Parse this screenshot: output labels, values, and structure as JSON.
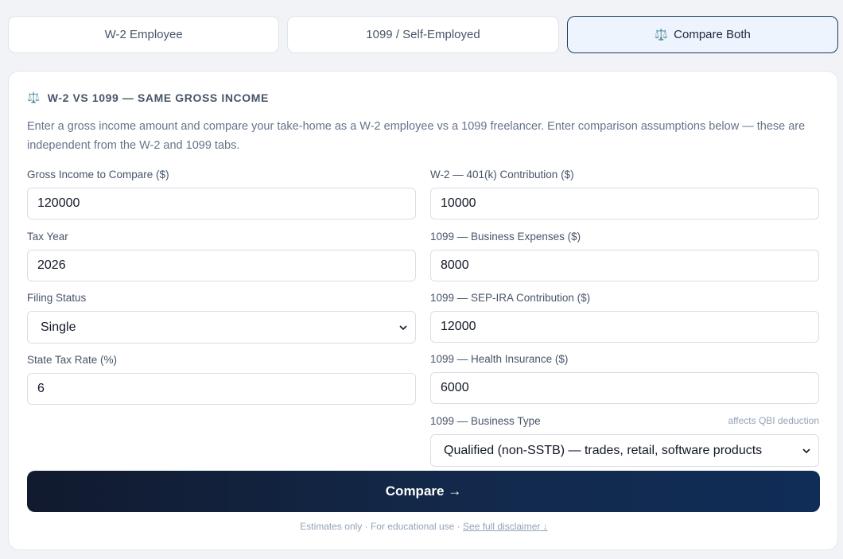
{
  "tabs": [
    {
      "label": "W-2 Employee",
      "icon": ""
    },
    {
      "label": "1099 / Self-Employed",
      "icon": ""
    },
    {
      "label": "Compare Both",
      "icon": "scales-icon"
    }
  ],
  "card": {
    "heading": "W-2 VS 1099 — SAME GROSS INCOME",
    "heading_icon": "scales-icon",
    "description": "Enter a gross income amount and compare your take-home as a W-2 employee vs a 1099 freelancer. Enter comparison assumptions below — these are independent from the W-2 and 1099 tabs."
  },
  "left_fields": {
    "gross": {
      "label": "Gross Income to Compare ($)",
      "value": "120000"
    },
    "tax_year": {
      "label": "Tax Year",
      "value": "2026"
    },
    "filing_status": {
      "label": "Filing Status",
      "value": "Single"
    },
    "state_rate": {
      "label": "State Tax Rate (%)",
      "value": "6"
    }
  },
  "right_fields": {
    "k401": {
      "label": "W-2 — 401(k) Contribution ($)",
      "value": "10000"
    },
    "biz_expenses": {
      "label": "1099 — Business Expenses ($)",
      "value": "8000"
    },
    "sep_ira": {
      "label": "1099 — SEP-IRA Contribution ($)",
      "value": "12000"
    },
    "health": {
      "label": "1099 — Health Insurance ($)",
      "value": "6000"
    },
    "biz_type": {
      "label": "1099 — Business Type",
      "hint": "affects QBI deduction",
      "value": "Qualified (non-SSTB) — trades, retail, software products"
    }
  },
  "compare_button": "Compare →",
  "footer": {
    "text": "Estimates only · For educational use · ",
    "link": "See full disclaimer ↓"
  },
  "colors": {
    "accent": "#1e3a5f",
    "active_tab_bg": "#eef4fd",
    "button_start": "#111a2e",
    "button_end": "#0f2d57"
  }
}
